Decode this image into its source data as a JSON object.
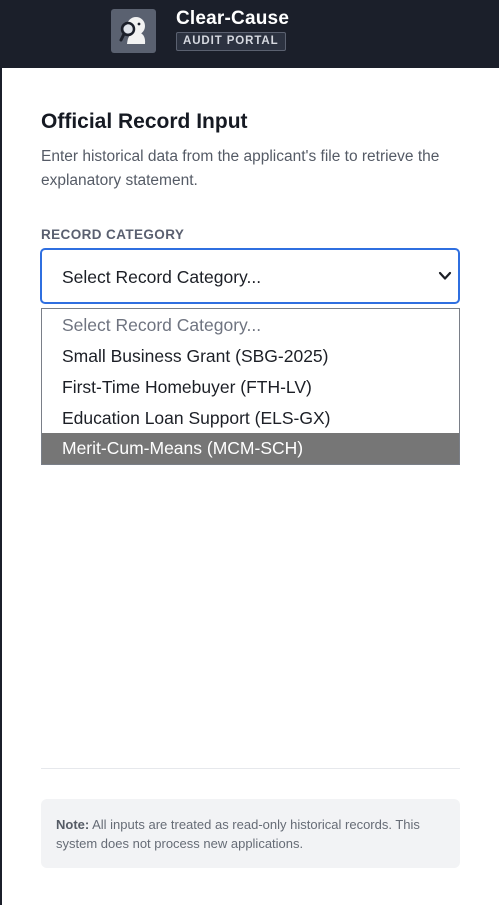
{
  "header": {
    "brand_title": "Clear-Cause",
    "brand_badge": "AUDIT PORTAL",
    "logo_icon": "magnifier-figure-icon"
  },
  "form": {
    "heading": "Official Record Input",
    "description": "Enter historical data from the applicant's file to retrieve the explanatory statement.",
    "field_label": "RECORD CATEGORY",
    "select_value": "Select Record Category...",
    "options": [
      "Select Record Category...",
      "Small Business Grant (SBG-2025)",
      "First-Time Homebuyer (FTH-LV)",
      "Education Loan Support (ELS-GX)",
      "Merit-Cum-Means (MCM-SCH)"
    ],
    "highlighted_option": "Merit-Cum-Means (MCM-SCH)"
  },
  "note": {
    "label": "Note:",
    "text": " All inputs are treated as read-only historical records. This system does not process new applications."
  },
  "colors": {
    "header_bg": "#1b1f2a",
    "focus_border": "#2f6fe0",
    "highlight_bg": "#767676"
  }
}
